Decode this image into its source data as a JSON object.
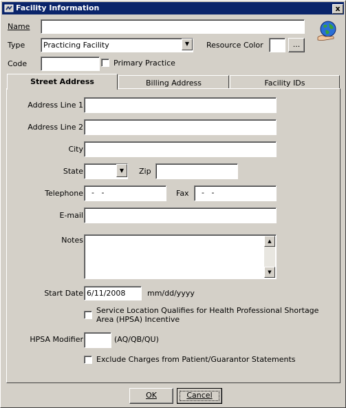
{
  "window": {
    "title": "Facility Information",
    "close_label": "x"
  },
  "top": {
    "name_label": "Name",
    "name_value": "",
    "type_label": "Type",
    "type_value": "Practicing Facility",
    "resource_color_label": "Resource Color",
    "resource_color_button": "...",
    "code_label": "Code",
    "code_value": "",
    "primary_practice_label": "Primary Practice"
  },
  "tabs": [
    {
      "label": "Street Address",
      "active": true
    },
    {
      "label": "Billing Address",
      "active": false
    },
    {
      "label": "Facility IDs",
      "active": false
    }
  ],
  "street": {
    "address1_label": "Address Line 1",
    "address2_label": "Address Line 2",
    "city_label": "City",
    "state_label": "State",
    "zip_label": "Zip",
    "telephone_label": "Telephone",
    "telephone_value": "  -   -",
    "fax_label": "Fax",
    "fax_value": "  -   -",
    "email_label": "E-mail",
    "notes_label": "Notes",
    "start_date_label": "Start Date",
    "start_date_value": "6/11/2008",
    "date_format_hint": "mm/dd/yyyy",
    "hpsa_qualify_label_line1": "Service Location Qualifies for Health Professional Shortage",
    "hpsa_qualify_label_line2": "Area (HPSA) Incentive",
    "hpsa_modifier_label": "HPSA Modifier",
    "hpsa_modifier_hint": "(AQ/QB/QU)",
    "exclude_charges_label": "Exclude Charges from Patient/Guarantor Statements"
  },
  "footer": {
    "ok_label": "OK",
    "cancel_label": "Cancel"
  },
  "colors": {
    "titlebar": "#0a246a",
    "face": "#d4d0c8"
  }
}
